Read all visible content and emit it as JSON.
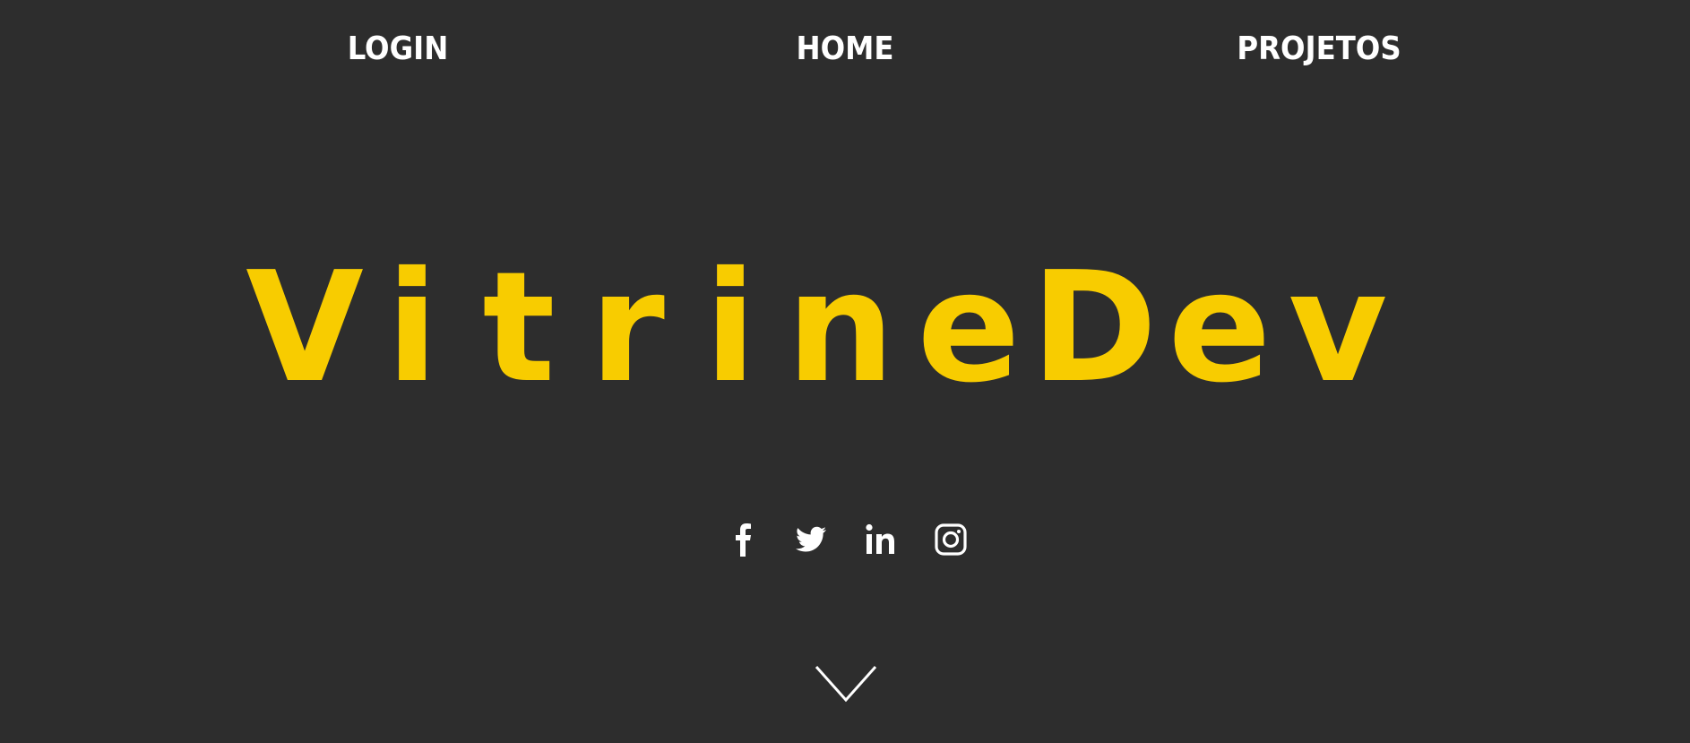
{
  "nav": {
    "login_label": "LOGIN",
    "home_label": "HOME",
    "projetos_label": "PROJETOS"
  },
  "hero": {
    "title": "VitrineDev",
    "letters": [
      "V",
      "i",
      "t",
      "r",
      "i",
      "n",
      "e",
      "D",
      "e",
      "v"
    ],
    "color": "#f8cc00"
  },
  "social": {
    "icons": [
      "facebook-icon",
      "twitter-icon",
      "linkedin-icon",
      "instagram-icon"
    ]
  },
  "scroll": {
    "icon": "chevron-down-icon"
  },
  "colors": {
    "background": "#2d2d2d",
    "text": "#ffffff",
    "accent": "#f8cc00"
  }
}
